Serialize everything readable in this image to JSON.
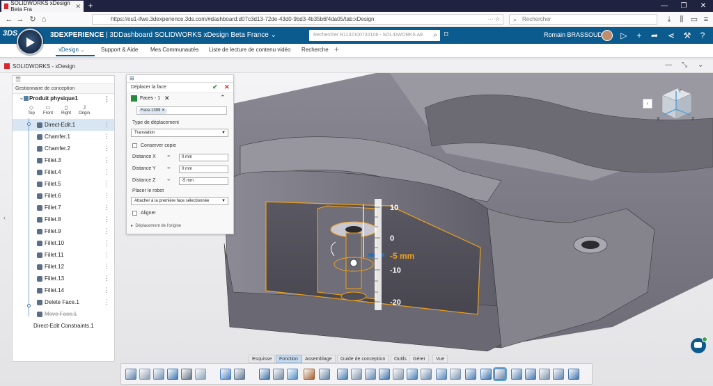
{
  "browser": {
    "tab_title": "SOLIDWORKS xDesign Beta Fra",
    "url": "https://eu1-ifwe.3dexperience.3ds.com/#dashboard:d07c3d13-72de-43d0-9bd3-4b35b6f4da05/tab:xDesign",
    "search_placeholder": "Rechercher"
  },
  "appbar": {
    "brand_bold": "3DEXPERIENCE",
    "title_rest": " | 3DDashboard SOLIDWORKS xDesign Beta France ⌄",
    "search_placeholder": "Rechercher R1132100732108 - SOLIDWORKS AE",
    "user": "Romain BRASSOUD"
  },
  "tabs": [
    {
      "label": "xDesign"
    },
    {
      "label": "Support & Aide"
    },
    {
      "label": "Mes Communautés"
    },
    {
      "label": "Liste de lecture de contenu vidéo"
    },
    {
      "label": "Recherche"
    }
  ],
  "widget": {
    "title": "SOLIDWORKS - xDesign"
  },
  "tree": {
    "header": "Gestionnaire de conception",
    "root": "Produit physique1",
    "views": [
      "Top",
      "Front",
      "Right",
      "Origin"
    ],
    "items": [
      {
        "label": "Direct-Edit.1"
      },
      {
        "label": "Chamfer.1"
      },
      {
        "label": "Chamfer.2"
      },
      {
        "label": "Fillet.3"
      },
      {
        "label": "Fillet.4"
      },
      {
        "label": "Fillet.5"
      },
      {
        "label": "Fillet.6"
      },
      {
        "label": "Fillet.7"
      },
      {
        "label": "Fillet.8"
      },
      {
        "label": "Fillet.9"
      },
      {
        "label": "Fillet.10"
      },
      {
        "label": "Fillet.11"
      },
      {
        "label": "Fillet.12"
      },
      {
        "label": "Fillet.13"
      },
      {
        "label": "Fillet.14"
      },
      {
        "label": "Delete Face.1"
      },
      {
        "label": "Move Face.1"
      }
    ],
    "constraints": "Direct-Edit Constraints.1"
  },
  "panel": {
    "title": "Déplacer la face",
    "faces_label": "Faces - 1",
    "face_chip": "Face.1399",
    "type_label": "Type de déplacement",
    "type_value": "Translation",
    "keep_copy": "Conserver copie",
    "dx_label": "Distance X",
    "dx_value": "0 mm",
    "dy_label": "Distance Y",
    "dy_value": "0 mm",
    "dz_label": "Distance Z",
    "dz_value": "-5 mm",
    "robot_label": "Placer le robot",
    "robot_value": "Attacher à la première face sélectionnée",
    "align": "Aligner",
    "origin": "Déplacement de l'origine"
  },
  "ruler": {
    "ticks": [
      "10",
      "0",
      "-10",
      "-20"
    ],
    "value": "-5 mm"
  },
  "cube": {
    "labels": [
      "Y",
      "X",
      "Z"
    ]
  },
  "actionbar": {
    "tabs": [
      "Esquisse",
      "Fonction",
      "Assemblage",
      "Guide de conception",
      "Outils",
      "Gérer",
      "Vue"
    ]
  },
  "colors": {
    "brand": "#0b5b8f",
    "highlight": "#f0a21a",
    "model": "#7d7b84"
  }
}
